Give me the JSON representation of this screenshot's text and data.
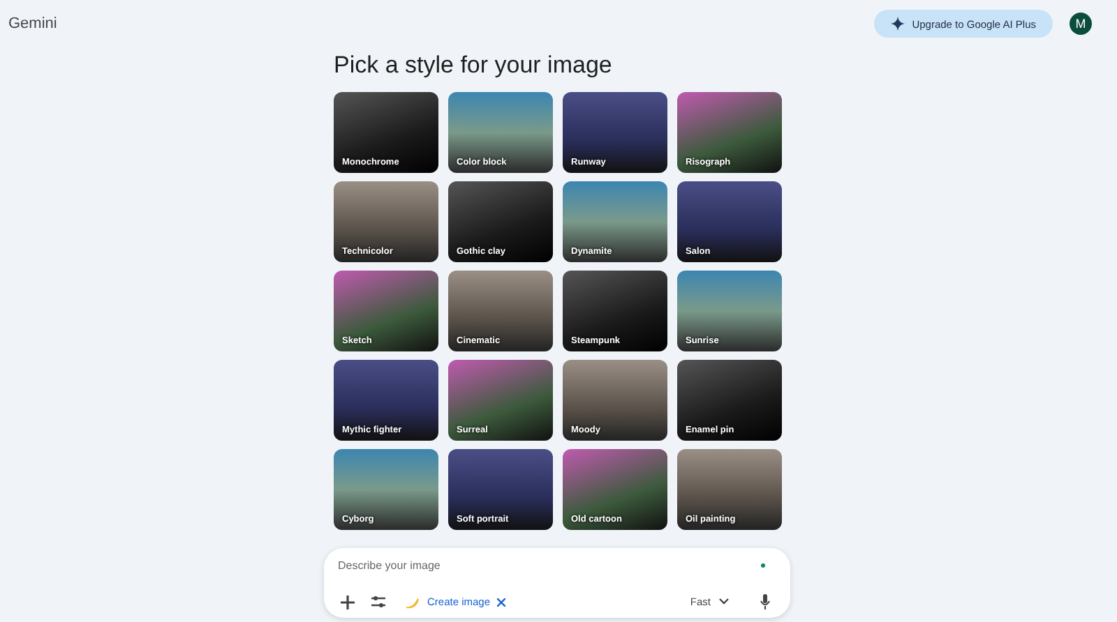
{
  "header": {
    "title": "Gemini",
    "upgrade_button": "Upgrade to Google AI Plus",
    "avatar": "M"
  },
  "heading": "Pick a style for your image",
  "styles": [
    {
      "label": "Monochrome"
    },
    {
      "label": "Color block"
    },
    {
      "label": "Runway"
    },
    {
      "label": "Risograph"
    },
    {
      "label": "Technicolor"
    },
    {
      "label": "Gothic clay"
    },
    {
      "label": "Dynamite"
    },
    {
      "label": "Salon"
    },
    {
      "label": "Sketch"
    },
    {
      "label": "Cinematic"
    },
    {
      "label": "Steampunk"
    },
    {
      "label": "Sunrise"
    },
    {
      "label": "Mythic fighter"
    },
    {
      "label": "Surreal"
    },
    {
      "label": "Moody"
    },
    {
      "label": "Enamel pin"
    },
    {
      "label": "Cyborg"
    },
    {
      "label": "Soft portrait"
    },
    {
      "label": "Old cartoon"
    },
    {
      "label": "Oil painting"
    }
  ],
  "composer": {
    "placeholder": "Describe your image",
    "tool_chip": "Create image",
    "mode": "Fast"
  }
}
